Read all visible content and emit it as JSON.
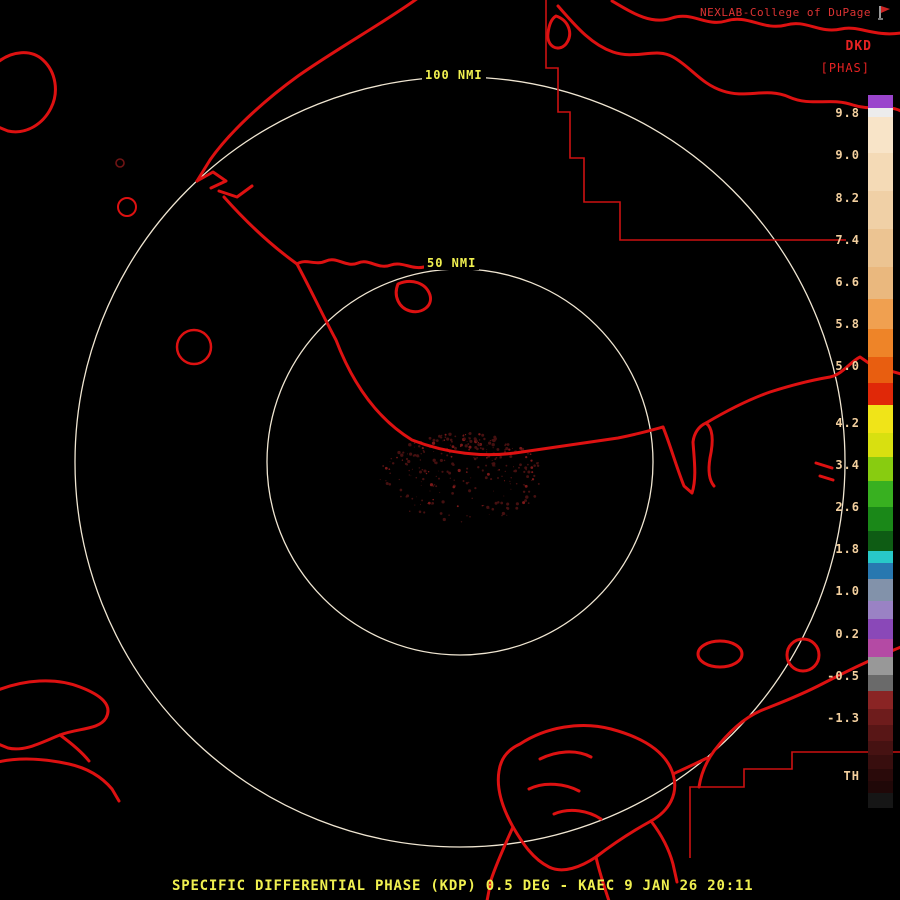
{
  "header": {
    "brand": "NEXLAB-College of DuPage",
    "product_code": "DKD",
    "units": "[PHAS]"
  },
  "rings": {
    "outer_label": "100 NMI",
    "inner_label": "50 NMI"
  },
  "colorbar": {
    "ticks": [
      "9.8",
      "9.0",
      "8.2",
      "7.4",
      "6.6",
      "5.8",
      "5.0",
      "4.2",
      "3.4",
      "2.6",
      "1.8",
      "1.0",
      "0.2",
      "-0.5",
      "-1.3",
      "TH"
    ],
    "segments": [
      {
        "color": "#9a44cc",
        "h": 13
      },
      {
        "color": "#ececec",
        "h": 9
      },
      {
        "color": "#f8e4c8",
        "h": 36
      },
      {
        "color": "#f4dab6",
        "h": 38
      },
      {
        "color": "#f0d0a6",
        "h": 38
      },
      {
        "color": "#ecc492",
        "h": 38
      },
      {
        "color": "#eab87e",
        "h": 32
      },
      {
        "color": "#f0a050",
        "h": 30
      },
      {
        "color": "#ee8428",
        "h": 28
      },
      {
        "color": "#e85e10",
        "h": 26
      },
      {
        "color": "#e02808",
        "h": 22
      },
      {
        "color": "#f0e418",
        "h": 28
      },
      {
        "color": "#d8e010",
        "h": 24
      },
      {
        "color": "#88cc10",
        "h": 24
      },
      {
        "color": "#38b020",
        "h": 26
      },
      {
        "color": "#1a8818",
        "h": 24
      },
      {
        "color": "#0e5c14",
        "h": 20
      },
      {
        "color": "#28c8c8",
        "h": 12
      },
      {
        "color": "#2878b0",
        "h": 16
      },
      {
        "color": "#8292aa",
        "h": 22
      },
      {
        "color": "#9a82c4",
        "h": 18
      },
      {
        "color": "#8a48b8",
        "h": 20
      },
      {
        "color": "#b44aa4",
        "h": 18
      },
      {
        "color": "#989898",
        "h": 18
      },
      {
        "color": "#6a6a6a",
        "h": 16
      },
      {
        "color": "#8a2424",
        "h": 18
      },
      {
        "color": "#6e1c1c",
        "h": 16
      },
      {
        "color": "#581616",
        "h": 16
      },
      {
        "color": "#461212",
        "h": 14
      },
      {
        "color": "#380e0e",
        "h": 14
      },
      {
        "color": "#2a0a0a",
        "h": 12
      },
      {
        "color": "#200808",
        "h": 12
      },
      {
        "color": "#161616",
        "h": 15
      }
    ]
  },
  "footer": {
    "status": "SPECIFIC DIFFERENTIAL PHASE (KDP) 0.5 DEG - KAEC 9 JAN 26 20:11"
  },
  "colors": {
    "map_outline": "#dd1111",
    "range_ring": "#f0e6d2",
    "label_yellow": "#f0f050",
    "text_red": "#e62222",
    "tick_text": "#f2cf9e",
    "background": "#000000"
  }
}
